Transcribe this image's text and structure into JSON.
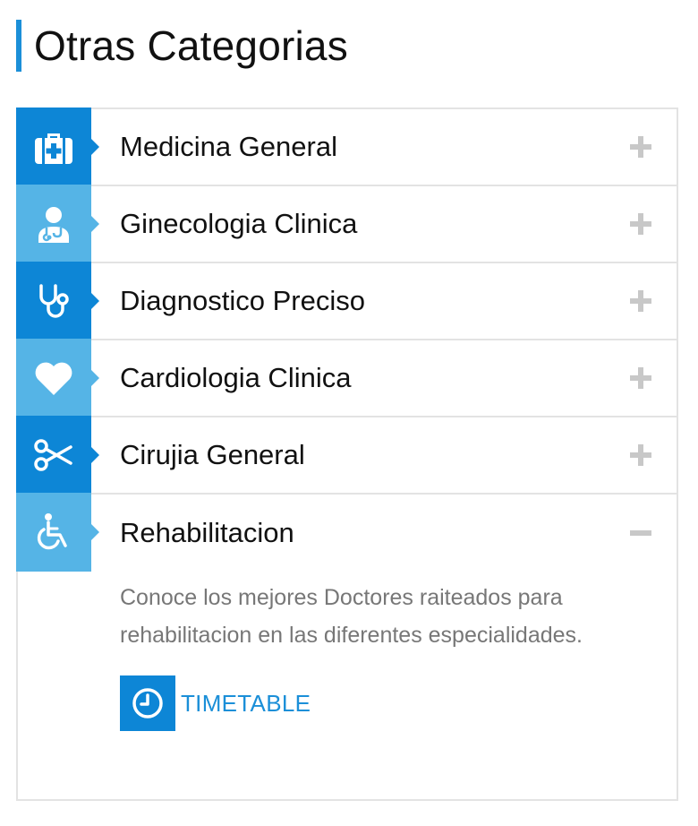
{
  "header": {
    "title": "Otras Categorias"
  },
  "accordion": {
    "items": [
      {
        "label": "Medicina General",
        "icon": "medical-kit-icon",
        "shade": "dark",
        "state": "collapsed"
      },
      {
        "label": "Ginecologia Clinica",
        "icon": "doctor-icon",
        "shade": "light",
        "state": "collapsed"
      },
      {
        "label": "Diagnostico Preciso",
        "icon": "stethoscope-icon",
        "shade": "dark",
        "state": "collapsed"
      },
      {
        "label": "Cardiologia Clinica",
        "icon": "heart-icon",
        "shade": "light",
        "state": "collapsed"
      },
      {
        "label": "Cirujia General",
        "icon": "scissors-icon",
        "shade": "dark",
        "state": "collapsed"
      },
      {
        "label": "Rehabilitacion",
        "icon": "wheelchair-icon",
        "shade": "light",
        "state": "expanded"
      }
    ],
    "expanded_panel": {
      "description": "Conoce los mejores Doctores raiteados para rehabilitacion en las diferentes especialidades.",
      "button_label": "TIMETABLE",
      "button_icon": "clock-icon"
    }
  },
  "colors": {
    "accent_dark": "#0d86d6",
    "accent_light": "#55b4e6",
    "toggle": "#c8c8c8",
    "body_text": "#777777"
  }
}
